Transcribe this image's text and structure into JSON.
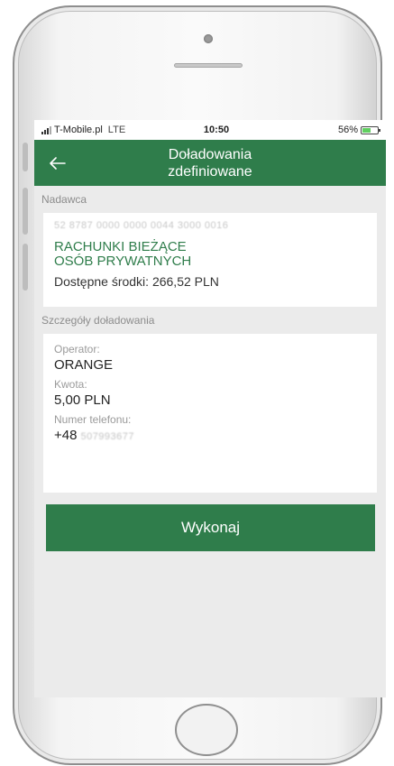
{
  "status_bar": {
    "carrier": "T-Mobile.pl",
    "network": "LTE",
    "time": "10:50",
    "battery": "56%",
    "battery_level": 0.56
  },
  "header": {
    "back_icon": "arrow-left-icon",
    "title_line1": "Doładowania",
    "title_line2": "zdefiniowane"
  },
  "sender": {
    "section_label": "Nadawca",
    "account_number": "52 8787 0000 0000 0044 3000 0016",
    "account_name_line1": "RACHUNKI BIEŻĄCE",
    "account_name_line2": "OSÓB PRYWATNYCH",
    "balance": "Dostępne środki: 266,52 PLN"
  },
  "details": {
    "section_label": "Szczegóły doładowania",
    "operator_label": "Operator:",
    "operator_value": "ORANGE",
    "amount_label": "Kwota:",
    "amount_value": "5,00 PLN",
    "phone_label": "Numer telefonu:",
    "phone_prefix": "+48",
    "phone_masked": "507993677"
  },
  "actions": {
    "execute_label": "Wykonaj"
  },
  "colors": {
    "brand_green": "#2f7d4b",
    "screen_bg": "#ebebeb"
  }
}
